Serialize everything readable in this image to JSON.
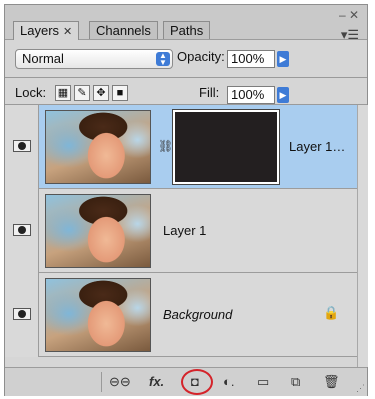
{
  "tabs": [
    {
      "label": "Layers",
      "close": "✕",
      "active": true
    },
    {
      "label": "Channels",
      "active": false
    },
    {
      "label": "Paths",
      "active": false
    }
  ],
  "panel_controls": {
    "collapse": "– ✕",
    "menu": "▾☰"
  },
  "blend_mode": {
    "value": "Normal",
    "arrows": "▲▼"
  },
  "opacity": {
    "label": "Opacity:",
    "value": "100%",
    "flyout": "▶"
  },
  "lock": {
    "label": "Lock:",
    "icons": [
      "lock-transparent-icon",
      "lock-image-brush-icon",
      "lock-position-move-icon",
      "lock-all-icon"
    ]
  },
  "fill": {
    "label": "Fill:",
    "value": "100%",
    "flyout": "▶"
  },
  "layers": [
    {
      "name": "Layer 1…",
      "selected": true,
      "has_mask": true,
      "italic": false,
      "locked": false
    },
    {
      "name": "Layer 1",
      "selected": false,
      "has_mask": false,
      "italic": false,
      "locked": false
    },
    {
      "name": "Background",
      "selected": false,
      "has_mask": false,
      "italic": true,
      "locked": true
    }
  ],
  "bottom_toolbar": {
    "link": "⊖⊖",
    "fx": "fx.",
    "add_mask": "◘",
    "adjustment": "◐.",
    "group": "▭",
    "new_layer": "⧉",
    "delete": "🗑"
  },
  "colors": {
    "selected_row": "#a9cdef",
    "highlight_circle": "#d4232a",
    "flyout_blue": "#3e7bd6"
  }
}
